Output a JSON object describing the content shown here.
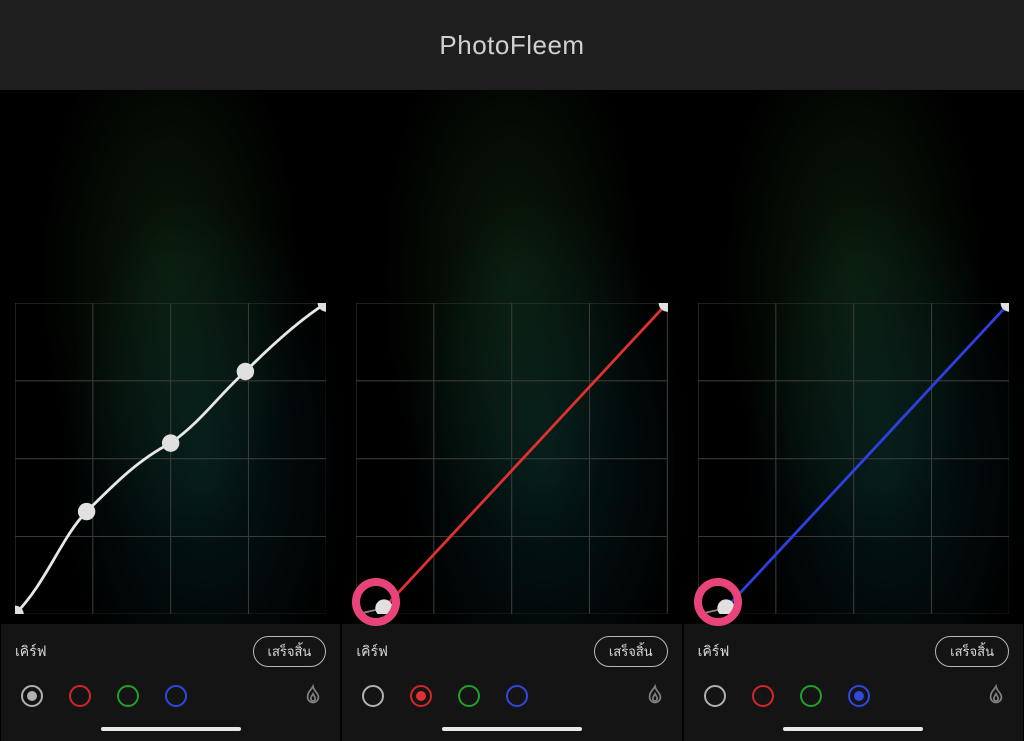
{
  "header": {
    "title": "PhotoFleem"
  },
  "labels": {
    "curve": "เคิร์ฟ",
    "done": "เสร็จสิ้น"
  },
  "colors": {
    "curve_white": "#e8e8e8",
    "curve_red": "#e03030",
    "curve_blue": "#3040e0",
    "grid": "#3a3a3a",
    "highlight": "#e8447a"
  },
  "channels": [
    "white",
    "red",
    "green",
    "blue"
  ],
  "panels": [
    {
      "active_channel": "white",
      "curve_color": "#e8e8e8",
      "points": [
        {
          "x": 0,
          "y": 0
        },
        {
          "x": 0.23,
          "y": 0.33
        },
        {
          "x": 0.5,
          "y": 0.55
        },
        {
          "x": 0.74,
          "y": 0.78
        },
        {
          "x": 1,
          "y": 1
        }
      ],
      "highlight_point": null
    },
    {
      "active_channel": "red",
      "curve_color": "#e03030",
      "points": [
        {
          "x": 0.09,
          "y": 0.02
        },
        {
          "x": 1,
          "y": 1
        }
      ],
      "highlight_point": 0
    },
    {
      "active_channel": "blue",
      "curve_color": "#3040e0",
      "points": [
        {
          "x": 0.09,
          "y": 0.02
        },
        {
          "x": 1,
          "y": 1
        }
      ],
      "highlight_point": 0
    }
  ]
}
